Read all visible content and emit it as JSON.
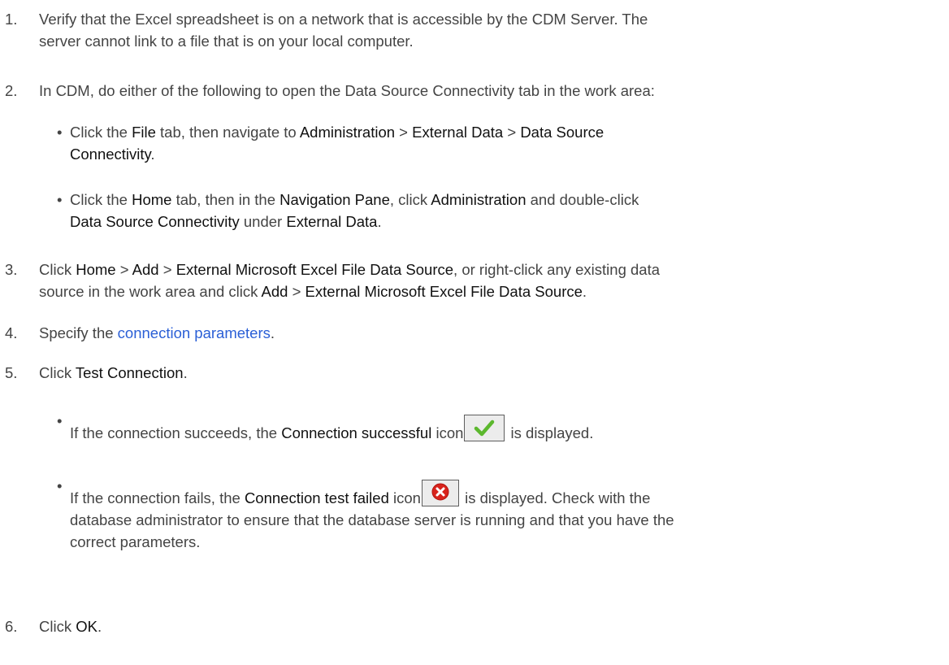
{
  "steps": [
    {
      "num": "1.",
      "lines": [
        [
          "Verify that the Excel spreadsheet is on a network that is accessible by the CDM Server. The"
        ],
        [
          "server cannot link to a file that is on your local computer."
        ]
      ]
    },
    {
      "num": "2.",
      "text": "In CDM, do either of the following to open the Data Source Connectivity tab in the work area:",
      "bullets": [
        {
          "pre": "Click the ",
          "b1": "File",
          "t2": " tab, then navigate to ",
          "b2": "Administration",
          "t3": " > ",
          "b3": "External Data",
          "t4": " > ",
          "b4": "Data Source",
          "b5": "Connectivity",
          "t5": "."
        },
        {
          "pre": "Click the ",
          "b1": "Home",
          "t2": " tab, then in the ",
          "b2": "Navigation Pane",
          "t3": ", click ",
          "b3": "Administration",
          "t4": " and double-click",
          "b4": "Data Source Connectivity",
          "t5": " under ",
          "b5": "External Data",
          "t6": "."
        }
      ]
    },
    {
      "num": "3.",
      "t1": "Click ",
      "b1": "Home",
      "t2": " > ",
      "b2": "Add",
      "t3": " > ",
      "b3": "External Microsoft Excel File Data Source",
      "t4": ", or right-click any existing data",
      "t5": "source in the work area and click ",
      "b4": "Add",
      "t6": " > ",
      "b5": "External Microsoft Excel File Data Source",
      "t7": "."
    },
    {
      "num": "4.",
      "t1": "Specify the ",
      "link": "connection parameters",
      "t2": "."
    },
    {
      "num": "5.",
      "t1": "Click ",
      "b1": "Test Connection",
      "t2": ".",
      "bullets": [
        {
          "pre": "If the connection succeeds, the ",
          "b1": "Connection successful",
          "t2": " icon",
          "t3": " is displayed."
        },
        {
          "pre": "If the connection fails, the ",
          "b1": "Connection test failed",
          "t2": " icon",
          "t3": " is displayed. Check with the",
          "l2": "database administrator to ensure that the database server is running and that you have the",
          "l3": "correct parameters."
        }
      ]
    },
    {
      "num": "6.",
      "t1": "Click ",
      "b1": "OK",
      "t2": "."
    }
  ],
  "icons": {
    "success": "check-mark-icon",
    "fail": "error-x-icon",
    "success_color": "#5cb82e",
    "fail_color": "#d8231c"
  },
  "colors": {
    "text": "#444444",
    "bold": "#111111",
    "link": "#2a5fd6"
  }
}
